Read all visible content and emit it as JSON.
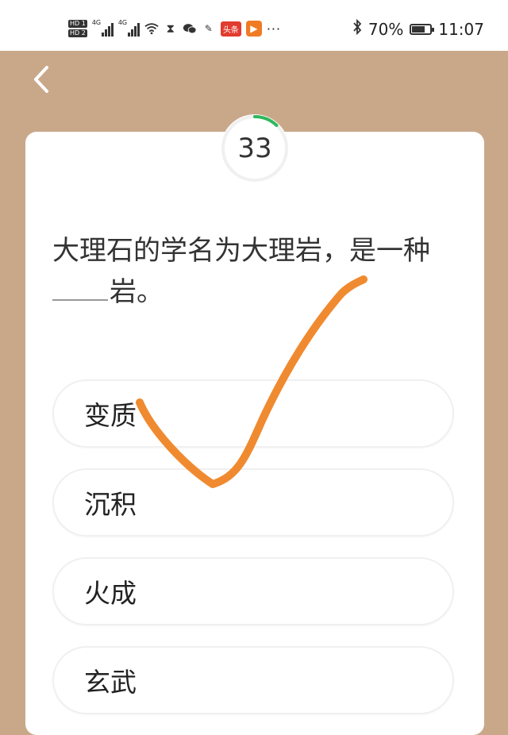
{
  "status_bar": {
    "hd_top": "HD 1",
    "hd_bottom": "HD 2",
    "signal_1_label": "4G",
    "signal_2_label": "4G",
    "red_badge": "头条",
    "orange_badge": "▶",
    "more": "···",
    "battery_percent": "70%",
    "battery_level": 0.7,
    "time": "11:07"
  },
  "timer": {
    "value": "33",
    "progress": 0.12,
    "accent": "#2eb85c"
  },
  "question": {
    "line1": "大理石的学名为大理岩，是一种",
    "line2_suffix": "岩。"
  },
  "options": [
    {
      "label": "变质"
    },
    {
      "label": "沉积"
    },
    {
      "label": "火成"
    },
    {
      "label": "玄武"
    }
  ],
  "colors": {
    "background": "#c9a88a",
    "checkmark": "#f08a30"
  }
}
